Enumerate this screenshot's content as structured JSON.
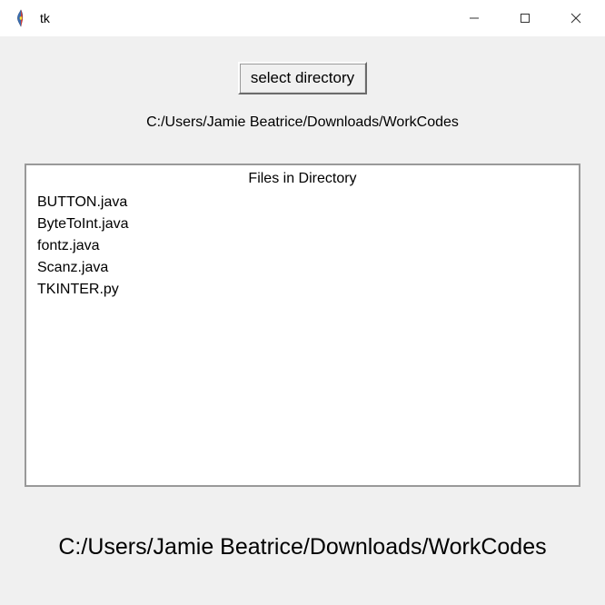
{
  "window": {
    "title": "tk"
  },
  "toolbar": {
    "select_button_label": "select directory"
  },
  "selected_path": "C:/Users/Jamie Beatrice/Downloads/WorkCodes",
  "panel": {
    "header": "Files in Directory",
    "files": [
      "BUTTON.java",
      "ByteToInt.java",
      "fontz.java",
      "Scanz.java",
      "TKINTER.py"
    ]
  },
  "footer_path": "C:/Users/Jamie Beatrice/Downloads/WorkCodes"
}
